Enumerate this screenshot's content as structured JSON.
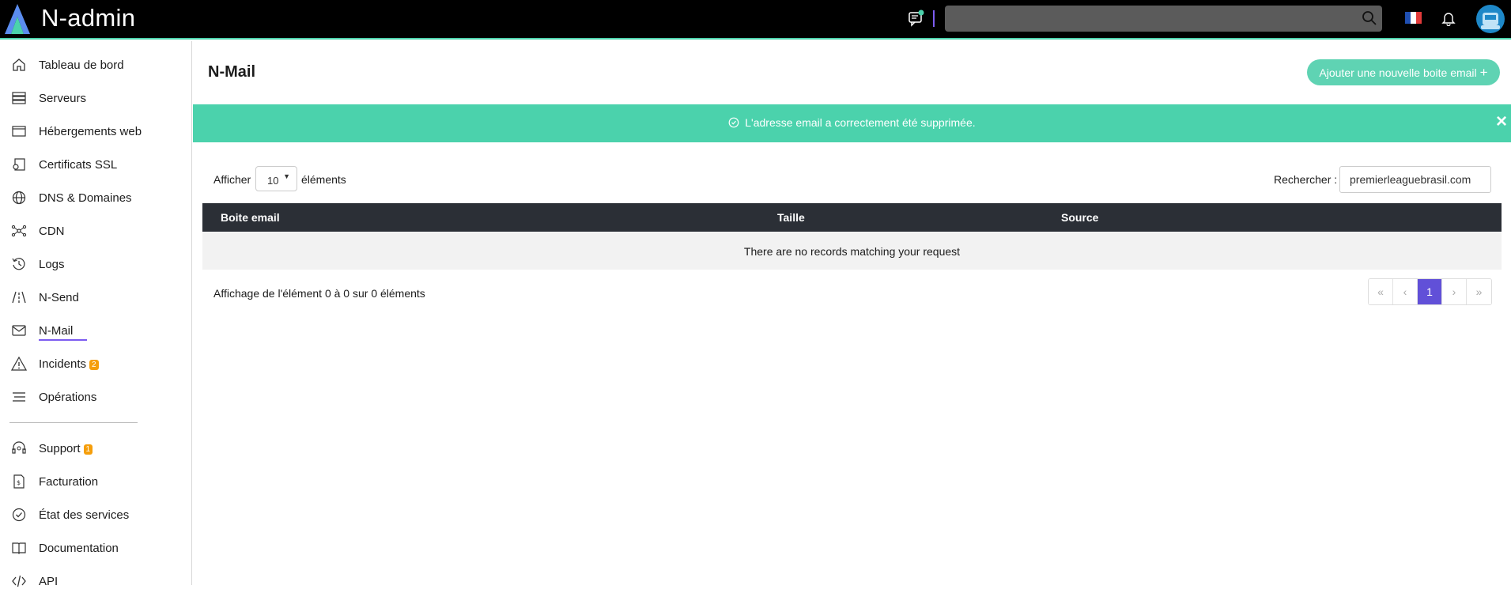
{
  "app": {
    "brand": "N-admin"
  },
  "topbar": {
    "search_placeholder": "",
    "flag_colors": [
      "#1f4fb2",
      "#ffffff",
      "#e23a3a"
    ],
    "accent": "#4bd2ac"
  },
  "sidebar": {
    "items": [
      {
        "label": "Tableau de bord",
        "icon": "home-icon"
      },
      {
        "label": "Serveurs",
        "icon": "server-icon"
      },
      {
        "label": "Hébergements web",
        "icon": "browser-icon"
      },
      {
        "label": "Certificats SSL",
        "icon": "certificate-icon"
      },
      {
        "label": "DNS & Domaines",
        "icon": "globe-icon"
      },
      {
        "label": "CDN",
        "icon": "network-icon"
      },
      {
        "label": "Logs",
        "icon": "history-icon"
      },
      {
        "label": "N-Send",
        "icon": "road-icon"
      },
      {
        "label": "N-Mail",
        "icon": "mail-icon",
        "active": true
      },
      {
        "label": "Incidents",
        "icon": "warning-icon",
        "badge": "2"
      },
      {
        "label": "Opérations",
        "icon": "list-icon"
      }
    ],
    "bottom_items": [
      {
        "label": "Support",
        "icon": "headset-icon",
        "badge": "1"
      },
      {
        "label": "Facturation",
        "icon": "invoice-icon"
      },
      {
        "label": "État des services",
        "icon": "check-circle-icon"
      },
      {
        "label": "Documentation",
        "icon": "book-icon"
      },
      {
        "label": "API",
        "icon": "code-icon"
      }
    ]
  },
  "main": {
    "title": "N-Mail",
    "add_button": "Ajouter une nouvelle boite email",
    "alert": {
      "message": "L'adresse email a correctement été supprimée.",
      "close": "×"
    },
    "length": {
      "prefix": "Afficher",
      "value": "10",
      "suffix": "éléments"
    },
    "search": {
      "label": "Rechercher :",
      "value": "premierleaguebrasil.com"
    },
    "table": {
      "columns": [
        "Boite email",
        "Taille",
        "Source"
      ],
      "empty": "There are no records matching your request"
    },
    "info": "Affichage de l'élément 0 à 0 sur 0 éléments",
    "pager": {
      "first": "«",
      "prev": "‹",
      "current": "1",
      "next": "›",
      "last": "»"
    }
  }
}
